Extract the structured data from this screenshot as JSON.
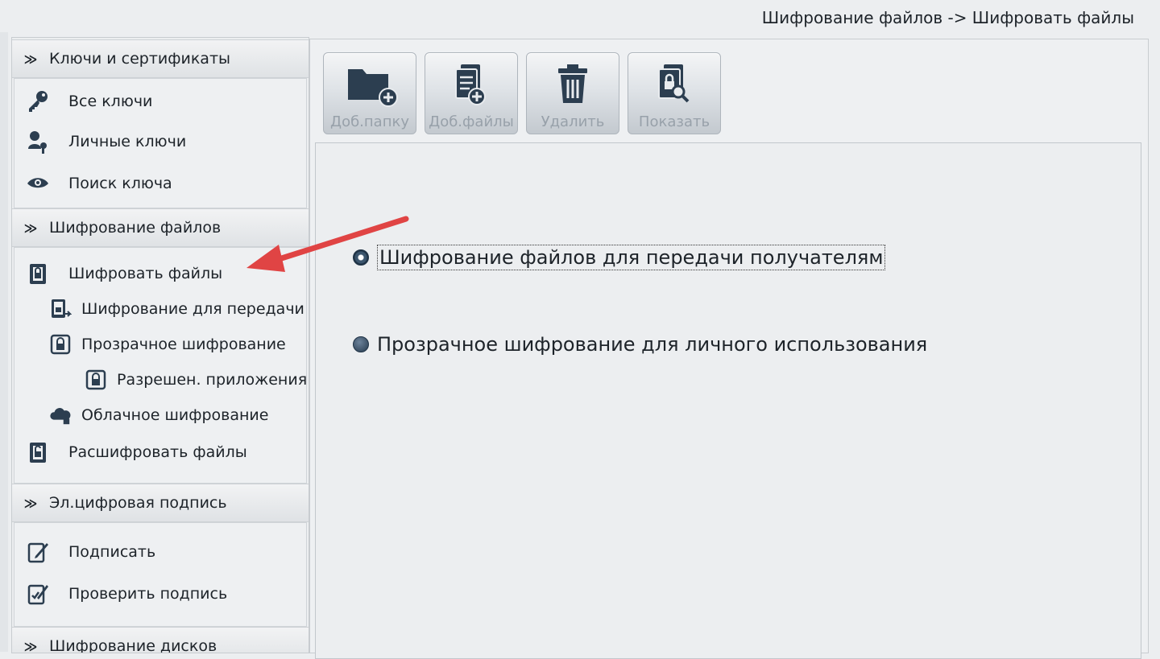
{
  "header": {
    "breadcrumb": "Шифрование файлов -> Шифровать файлы"
  },
  "sidebar": {
    "sections": [
      {
        "title": "Ключи и сертификаты",
        "items": [
          "Все ключи",
          "Личные ключи",
          "Поиск ключа"
        ]
      },
      {
        "title": "Шифрование файлов",
        "items": [
          "Шифровать файлы",
          "Шифрование для передачи",
          "Прозрачное шифрование",
          "Разрешен. приложения",
          "Облачное шифрование",
          "Расшифровать файлы"
        ]
      },
      {
        "title": "Эл.цифровая подпись",
        "items": [
          "Подписать",
          "Проверить подпись"
        ]
      },
      {
        "title": "Шифрование дисков"
      }
    ]
  },
  "toolbar": {
    "buttons": [
      {
        "label": "Доб.папку",
        "icon": "folder-add-icon",
        "enabled": false
      },
      {
        "label": "Доб.файлы",
        "icon": "files-add-icon",
        "enabled": false
      },
      {
        "label": "Удалить",
        "icon": "trash-icon",
        "enabled": false
      },
      {
        "label": "Показать",
        "icon": "show-lock-icon",
        "enabled": false
      }
    ]
  },
  "options": {
    "selected_index": 0,
    "items": [
      "Шифрование файлов для передачи получателям",
      "Прозрачное шифрование для личного использования"
    ]
  },
  "annotation": {
    "arrow_color": "#e04444"
  },
  "colors": {
    "icon": "#2c3e50",
    "disabled_text": "#98a1aa"
  }
}
